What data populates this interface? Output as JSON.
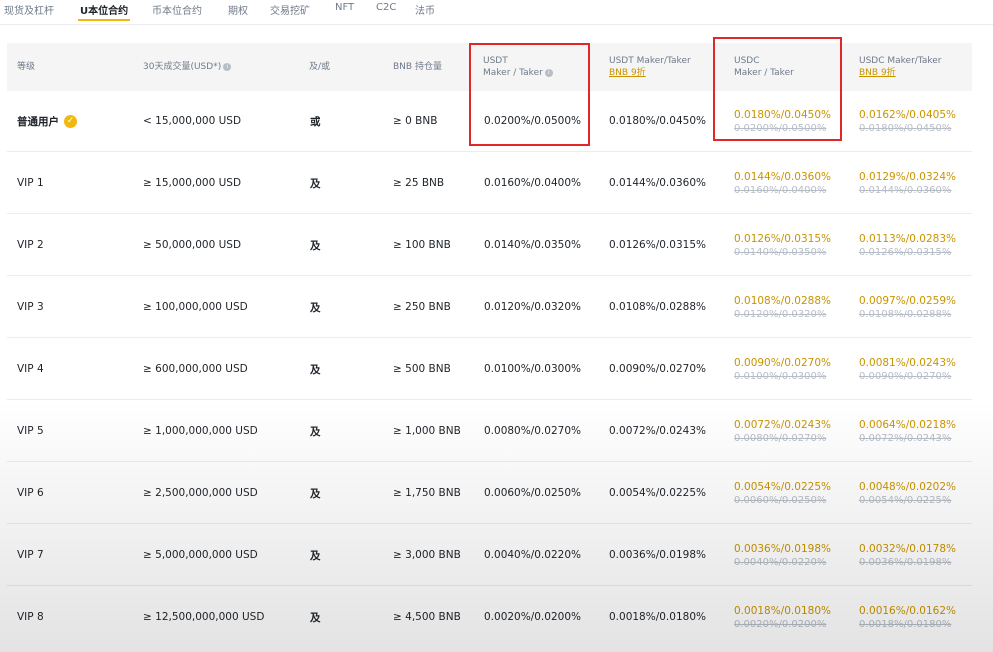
{
  "tabs": [
    {
      "label": "现货及杠杆"
    },
    {
      "label": "U本位合约"
    },
    {
      "label": "币本位合约"
    },
    {
      "label": "期权"
    },
    {
      "label": "交易挖矿"
    },
    {
      "label": "NFT"
    },
    {
      "label": "C2C"
    },
    {
      "label": "法币"
    }
  ],
  "table": {
    "headers": {
      "level": "等级",
      "volume": "30天成交量(USD*)",
      "andor": "及/或",
      "bnb": "BNB 持仓量",
      "usdt_line1": "USDT",
      "usdt_line2": "Maker / Taker",
      "usdt_bnb_line1": "USDT Maker/Taker",
      "usdt_bnb_discount": "BNB 9折",
      "usdc_line1": "USDC",
      "usdc_line2": "Maker / Taker",
      "usdc_bnb_line1": "USDC Maker/Taker",
      "usdc_bnb_discount": "BNB 9折"
    },
    "rows": [
      {
        "level": "普通用户",
        "volume": "< 15,000,000 USD",
        "andor": "或",
        "bnb": "≥ 0 BNB",
        "usdt": "0.0200%/0.0500%",
        "usdt_bnb": "0.0180%/0.0450%",
        "usdc": "0.0180%/0.0450%",
        "usdc_old": "0.0200%/0.0500%",
        "usdc_bnb": "0.0162%/0.0405%",
        "usdc_bnb_old": "0.0180%/0.0450%"
      },
      {
        "level": "VIP 1",
        "volume": "≥ 15,000,000 USD",
        "andor": "及",
        "bnb": "≥ 25 BNB",
        "usdt": "0.0160%/0.0400%",
        "usdt_bnb": "0.0144%/0.0360%",
        "usdc": "0.0144%/0.0360%",
        "usdc_old": "0.0160%/0.0400%",
        "usdc_bnb": "0.0129%/0.0324%",
        "usdc_bnb_old": "0.0144%/0.0360%"
      },
      {
        "level": "VIP 2",
        "volume": "≥ 50,000,000 USD",
        "andor": "及",
        "bnb": "≥ 100 BNB",
        "usdt": "0.0140%/0.0350%",
        "usdt_bnb": "0.0126%/0.0315%",
        "usdc": "0.0126%/0.0315%",
        "usdc_old": "0.0140%/0.0350%",
        "usdc_bnb": "0.0113%/0.0283%",
        "usdc_bnb_old": "0.0126%/0.0315%"
      },
      {
        "level": "VIP 3",
        "volume": "≥ 100,000,000 USD",
        "andor": "及",
        "bnb": "≥ 250 BNB",
        "usdt": "0.0120%/0.0320%",
        "usdt_bnb": "0.0108%/0.0288%",
        "usdc": "0.0108%/0.0288%",
        "usdc_old": "0.0120%/0.0320%",
        "usdc_bnb": "0.0097%/0.0259%",
        "usdc_bnb_old": "0.0108%/0.0288%"
      },
      {
        "level": "VIP 4",
        "volume": "≥ 600,000,000 USD",
        "andor": "及",
        "bnb": "≥ 500 BNB",
        "usdt": "0.0100%/0.0300%",
        "usdt_bnb": "0.0090%/0.0270%",
        "usdc": "0.0090%/0.0270%",
        "usdc_old": "0.0100%/0.0300%",
        "usdc_bnb": "0.0081%/0.0243%",
        "usdc_bnb_old": "0.0090%/0.0270%"
      },
      {
        "level": "VIP 5",
        "volume": "≥ 1,000,000,000 USD",
        "andor": "及",
        "bnb": "≥ 1,000 BNB",
        "usdt": "0.0080%/0.0270%",
        "usdt_bnb": "0.0072%/0.0243%",
        "usdc": "0.0072%/0.0243%",
        "usdc_old": "0.0080%/0.0270%",
        "usdc_bnb": "0.0064%/0.0218%",
        "usdc_bnb_old": "0.0072%/0.0243%"
      },
      {
        "level": "VIP 6",
        "volume": "≥ 2,500,000,000 USD",
        "andor": "及",
        "bnb": "≥ 1,750 BNB",
        "usdt": "0.0060%/0.0250%",
        "usdt_bnb": "0.0054%/0.0225%",
        "usdc": "0.0054%/0.0225%",
        "usdc_old": "0.0060%/0.0250%",
        "usdc_bnb": "0.0048%/0.0202%",
        "usdc_bnb_old": "0.0054%/0.0225%"
      },
      {
        "level": "VIP 7",
        "volume": "≥ 5,000,000,000 USD",
        "andor": "及",
        "bnb": "≥ 3,000 BNB",
        "usdt": "0.0040%/0.0220%",
        "usdt_bnb": "0.0036%/0.0198%",
        "usdc": "0.0036%/0.0198%",
        "usdc_old": "0.0040%/0.0220%",
        "usdc_bnb": "0.0032%/0.0178%",
        "usdc_bnb_old": "0.0036%/0.0198%"
      },
      {
        "level": "VIP 8",
        "volume": "≥ 12,500,000,000 USD",
        "andor": "及",
        "bnb": "≥ 4,500 BNB",
        "usdt": "0.0020%/0.0200%",
        "usdt_bnb": "0.0018%/0.0180%",
        "usdc": "0.0018%/0.0180%",
        "usdc_old": "0.0020%/0.0200%",
        "usdc_bnb": "0.0016%/0.0162%",
        "usdc_bnb_old": "0.0018%/0.0180%"
      }
    ]
  },
  "colors": {
    "accent": "#f0b90b",
    "discount_text": "#c99400",
    "highlight_box": "#e02828"
  }
}
